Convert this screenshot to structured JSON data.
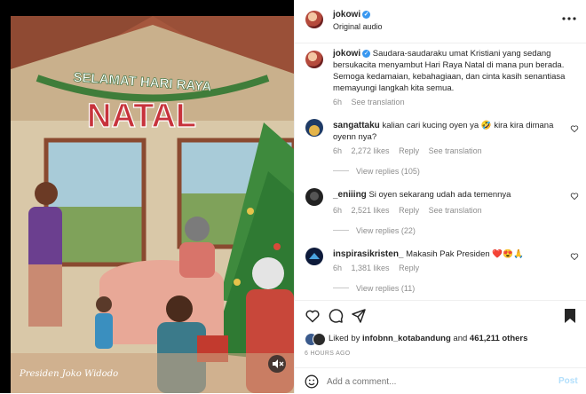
{
  "post": {
    "artwork_banner": "SELAMAT HARI RAYA",
    "artwork_title": "NATAL",
    "artwork_signature": "Presiden Joko Widodo"
  },
  "header": {
    "username": "jokowi",
    "audio": "Original audio",
    "more_icon": "more-horizontal-icon"
  },
  "caption": {
    "username": "jokowi",
    "text": "Saudara-saudaraku umat Kristiani yang sedang bersukacita menyambut Hari Raya Natal di mana pun berada. Semoga kedamaian, kebahagiaan, dan cinta kasih senantiasa memayungi langkah kita semua.",
    "time": "6h",
    "see_translation": "See translation"
  },
  "comments": [
    {
      "username": "sangattaku",
      "text": "kalian cari kucing oyen ya 🤣 kira kira dimana oyenn nya?",
      "time": "6h",
      "likes": "2,272 likes",
      "reply": "Reply",
      "translation": "See translation",
      "view_replies": "View replies (105)"
    },
    {
      "username": "_eniiing",
      "text": "Si oyen sekarang udah ada temennya",
      "time": "6h",
      "likes": "2,521 likes",
      "reply": "Reply",
      "translation": "See translation",
      "view_replies": "View replies (22)"
    },
    {
      "username": "inspirasikristen_",
      "text": "Makasih Pak Presiden ❤️😍🙏",
      "time": "6h",
      "likes": "1,381 likes",
      "reply": "Reply",
      "translation": "",
      "view_replies": "View replies (11)"
    }
  ],
  "actions": {
    "liked_by_prefix": "Liked by",
    "liked_by_user": "infobnn_kotabandung",
    "liked_by_and": "and",
    "liked_by_count": "461,211 others",
    "timestamp": "6 HOURS AGO"
  },
  "add_comment": {
    "placeholder": "Add a comment...",
    "post_label": "Post"
  },
  "colors": {
    "link": "#00376b",
    "post_disabled": "#b2dffc",
    "verified": "#3897f0",
    "muted": "#8e8e8e"
  }
}
